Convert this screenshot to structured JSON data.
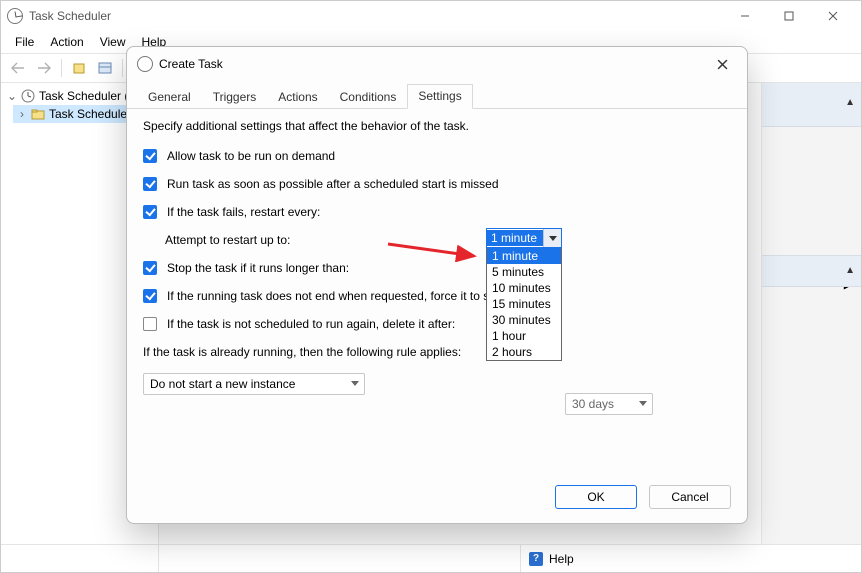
{
  "app": {
    "title": "Task Scheduler"
  },
  "menu": {
    "file": "File",
    "action": "Action",
    "view": "View",
    "help": "Help"
  },
  "tree": {
    "root": "Task Scheduler (L",
    "child": "Task Schedule"
  },
  "status": {
    "help": "Help"
  },
  "window_buttons": {
    "min": "—",
    "max": "▢",
    "close": "✕"
  },
  "dialog": {
    "title": "Create Task",
    "tabs": {
      "general": "General",
      "triggers": "Triggers",
      "actions": "Actions",
      "conditions": "Conditions",
      "settings": "Settings"
    },
    "active_tab": "settings",
    "desc": "Specify additional settings that affect the behavior of the task.",
    "opts": {
      "allow_on_demand": "Allow task to be run on demand",
      "run_asap": "Run task as soon as possible after a scheduled start is missed",
      "restart_fail": "If the task fails, restart every:",
      "attempt_label": "Attempt to restart up to:",
      "stop_longer": "Stop the task if it runs longer than:",
      "force_stop": "If the running task does not end when requested, force it to st",
      "delete_after": "If the task is not scheduled to run again, delete it after:",
      "already_running": "If the task is already running, then the following rule applies:"
    },
    "restart_dropdown": {
      "selected": "1 minute",
      "options": [
        "1 minute",
        "5 minutes",
        "10 minutes",
        "15 minutes",
        "30 minutes",
        "1 hour",
        "2 hours"
      ]
    },
    "delete_after_value": "30 days",
    "running_rule": "Do not start a new instance",
    "buttons": {
      "ok": "OK",
      "cancel": "Cancel"
    }
  }
}
